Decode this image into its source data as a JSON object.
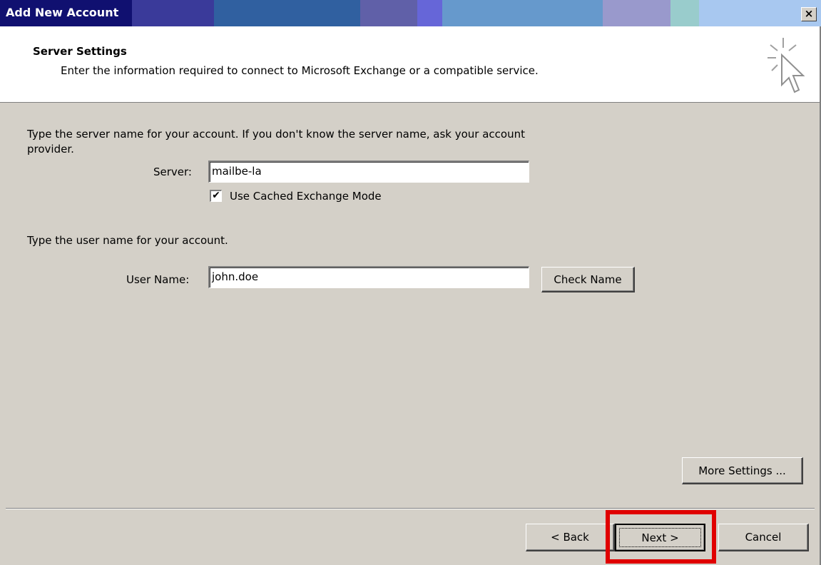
{
  "window": {
    "title": "Add New Account",
    "close_glyph": "×",
    "titlebar_colors": [
      "#101070",
      "#3a3a9a",
      "#3060a0",
      "#6060a8",
      "#6666d8",
      "#6699cc",
      "#9999cc",
      "#99cccc",
      "#a8c8f0"
    ]
  },
  "header": {
    "title": "Server Settings",
    "subtitle": "Enter the information required to connect to Microsoft Exchange or a compatible service.",
    "icon": "cursor-sparkle-icon"
  },
  "server_section": {
    "instructions": "Type the server name for your account. If you don't know the server name, ask your account provider.",
    "server_label": "Server:",
    "server_value": "mailbe-la",
    "cached_mode_label": "Use Cached Exchange Mode",
    "cached_mode_checked": true,
    "check_mark": "✔"
  },
  "user_section": {
    "instructions": "Type the user name for your account.",
    "username_label": "User Name:",
    "username_value": "john.doe",
    "check_name_label": "Check Name"
  },
  "buttons": {
    "more_settings": "More Settings ...",
    "back": "< Back",
    "next": "Next >",
    "cancel": "Cancel"
  },
  "highlight": {
    "target": "next-button",
    "color": "#e00000"
  }
}
